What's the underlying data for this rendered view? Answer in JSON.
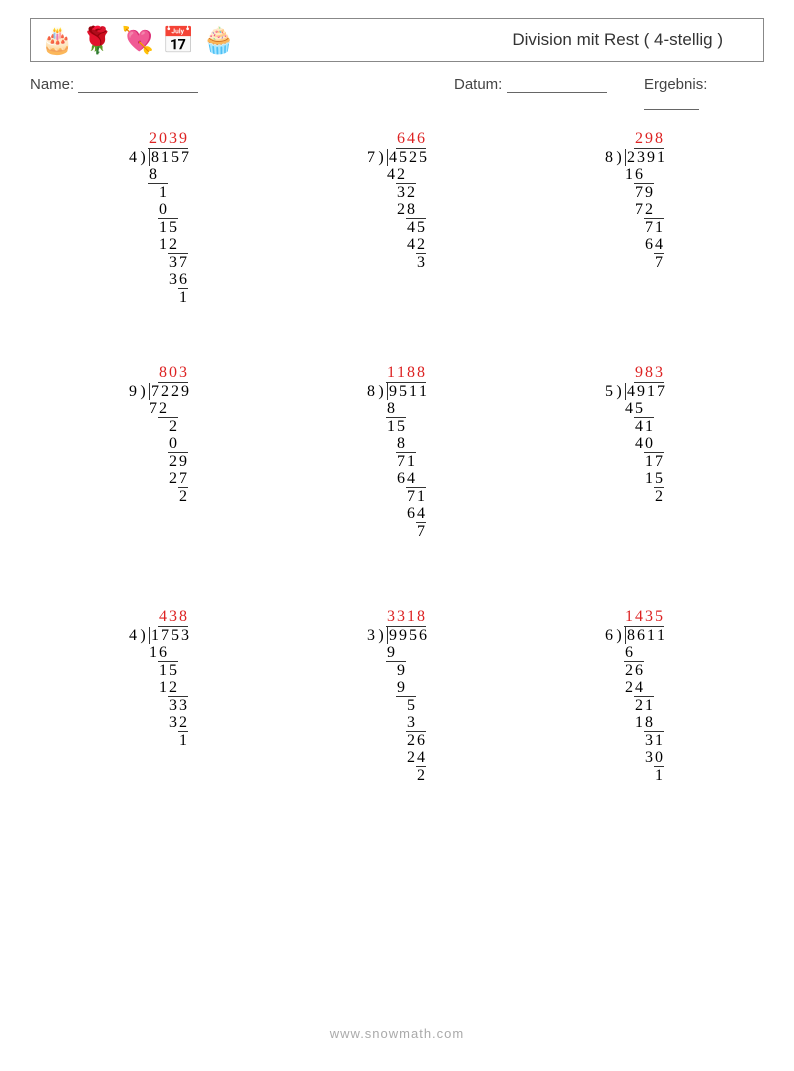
{
  "header": {
    "title": "Division mit Rest ( 4-stellig )",
    "icons": [
      "cake-icon",
      "rose-icon",
      "heart-lock-icon",
      "calendar-heart-icon",
      "cupcake-icon"
    ]
  },
  "fields": {
    "name_label": "Name:",
    "date_label": "Datum:",
    "result_label": "Ergebnis:"
  },
  "problems": [
    {
      "divisor": "4",
      "dividend": "8157",
      "quotient": "2039",
      "steps": [
        {
          "txt": "8",
          "indent": 0,
          "over": false,
          "width": 1
        },
        {
          "txt": "1",
          "indent": 0,
          "over": true,
          "width": 2
        },
        {
          "txt": "0",
          "indent": 1,
          "over": false,
          "width": 1
        },
        {
          "txt": "15",
          "indent": 1,
          "over": true,
          "width": 2
        },
        {
          "txt": "12",
          "indent": 1,
          "over": false,
          "width": 2
        },
        {
          "txt": "37",
          "indent": 2,
          "over": true,
          "width": 2
        },
        {
          "txt": "36",
          "indent": 2,
          "over": false,
          "width": 2
        },
        {
          "txt": "1",
          "indent": 3,
          "over": true,
          "width": 1
        }
      ]
    },
    {
      "divisor": "7",
      "dividend": "4525",
      "quotient": "646",
      "steps": [
        {
          "txt": "42",
          "indent": 0,
          "over": false,
          "width": 2
        },
        {
          "txt": "32",
          "indent": 1,
          "over": true,
          "width": 2
        },
        {
          "txt": "28",
          "indent": 1,
          "over": false,
          "width": 2
        },
        {
          "txt": "45",
          "indent": 2,
          "over": true,
          "width": 2
        },
        {
          "txt": "42",
          "indent": 2,
          "over": false,
          "width": 2
        },
        {
          "txt": "3",
          "indent": 3,
          "over": true,
          "width": 1
        }
      ]
    },
    {
      "divisor": "8",
      "dividend": "2391",
      "quotient": "298",
      "steps": [
        {
          "txt": "16",
          "indent": 0,
          "over": false,
          "width": 2
        },
        {
          "txt": "79",
          "indent": 1,
          "over": true,
          "width": 2
        },
        {
          "txt": "72",
          "indent": 1,
          "over": false,
          "width": 2
        },
        {
          "txt": "71",
          "indent": 2,
          "over": true,
          "width": 2
        },
        {
          "txt": "64",
          "indent": 2,
          "over": false,
          "width": 2
        },
        {
          "txt": "7",
          "indent": 3,
          "over": true,
          "width": 1
        }
      ]
    },
    {
      "divisor": "9",
      "dividend": "7229",
      "quotient": "803",
      "steps": [
        {
          "txt": "72",
          "indent": 0,
          "over": false,
          "width": 2
        },
        {
          "txt": "2",
          "indent": 1,
          "over": true,
          "width": 2
        },
        {
          "txt": "0",
          "indent": 2,
          "over": false,
          "width": 1
        },
        {
          "txt": "29",
          "indent": 2,
          "over": true,
          "width": 2
        },
        {
          "txt": "27",
          "indent": 2,
          "over": false,
          "width": 2
        },
        {
          "txt": "2",
          "indent": 3,
          "over": true,
          "width": 1
        }
      ]
    },
    {
      "divisor": "8",
      "dividend": "9511",
      "quotient": "1188",
      "steps": [
        {
          "txt": "8",
          "indent": 0,
          "over": false,
          "width": 1
        },
        {
          "txt": "15",
          "indent": 0,
          "over": true,
          "width": 2
        },
        {
          "txt": "8",
          "indent": 1,
          "over": false,
          "width": 1
        },
        {
          "txt": "71",
          "indent": 1,
          "over": true,
          "width": 2
        },
        {
          "txt": "64",
          "indent": 1,
          "over": false,
          "width": 2
        },
        {
          "txt": "71",
          "indent": 2,
          "over": true,
          "width": 2
        },
        {
          "txt": "64",
          "indent": 2,
          "over": false,
          "width": 2
        },
        {
          "txt": "7",
          "indent": 3,
          "over": true,
          "width": 1
        }
      ]
    },
    {
      "divisor": "5",
      "dividend": "4917",
      "quotient": "983",
      "steps": [
        {
          "txt": "45",
          "indent": 0,
          "over": false,
          "width": 2
        },
        {
          "txt": "41",
          "indent": 1,
          "over": true,
          "width": 2
        },
        {
          "txt": "40",
          "indent": 1,
          "over": false,
          "width": 2
        },
        {
          "txt": "17",
          "indent": 2,
          "over": true,
          "width": 2
        },
        {
          "txt": "15",
          "indent": 2,
          "over": false,
          "width": 2
        },
        {
          "txt": "2",
          "indent": 3,
          "over": true,
          "width": 1
        }
      ]
    },
    {
      "divisor": "4",
      "dividend": "1753",
      "quotient": "438",
      "steps": [
        {
          "txt": "16",
          "indent": 0,
          "over": false,
          "width": 2
        },
        {
          "txt": "15",
          "indent": 1,
          "over": true,
          "width": 2
        },
        {
          "txt": "12",
          "indent": 1,
          "over": false,
          "width": 2
        },
        {
          "txt": "33",
          "indent": 2,
          "over": true,
          "width": 2
        },
        {
          "txt": "32",
          "indent": 2,
          "over": false,
          "width": 2
        },
        {
          "txt": "1",
          "indent": 3,
          "over": true,
          "width": 1
        }
      ]
    },
    {
      "divisor": "3",
      "dividend": "9956",
      "quotient": "3318",
      "steps": [
        {
          "txt": "9",
          "indent": 0,
          "over": false,
          "width": 1
        },
        {
          "txt": "9",
          "indent": 0,
          "over": true,
          "width": 2
        },
        {
          "txt": "9",
          "indent": 1,
          "over": false,
          "width": 1
        },
        {
          "txt": "5",
          "indent": 1,
          "over": true,
          "width": 2
        },
        {
          "txt": "3",
          "indent": 2,
          "over": false,
          "width": 1
        },
        {
          "txt": "26",
          "indent": 2,
          "over": true,
          "width": 2
        },
        {
          "txt": "24",
          "indent": 2,
          "over": false,
          "width": 2
        },
        {
          "txt": "2",
          "indent": 3,
          "over": true,
          "width": 1
        }
      ]
    },
    {
      "divisor": "6",
      "dividend": "8611",
      "quotient": "1435",
      "steps": [
        {
          "txt": "6",
          "indent": 0,
          "over": false,
          "width": 1
        },
        {
          "txt": "26",
          "indent": 0,
          "over": true,
          "width": 2
        },
        {
          "txt": "24",
          "indent": 0,
          "over": false,
          "width": 2
        },
        {
          "txt": "21",
          "indent": 1,
          "over": true,
          "width": 2
        },
        {
          "txt": "18",
          "indent": 1,
          "over": false,
          "width": 2
        },
        {
          "txt": "31",
          "indent": 2,
          "over": true,
          "width": 2
        },
        {
          "txt": "30",
          "indent": 2,
          "over": false,
          "width": 2
        },
        {
          "txt": "1",
          "indent": 3,
          "over": true,
          "width": 1
        }
      ]
    }
  ],
  "footer": "www.snowmath.com"
}
